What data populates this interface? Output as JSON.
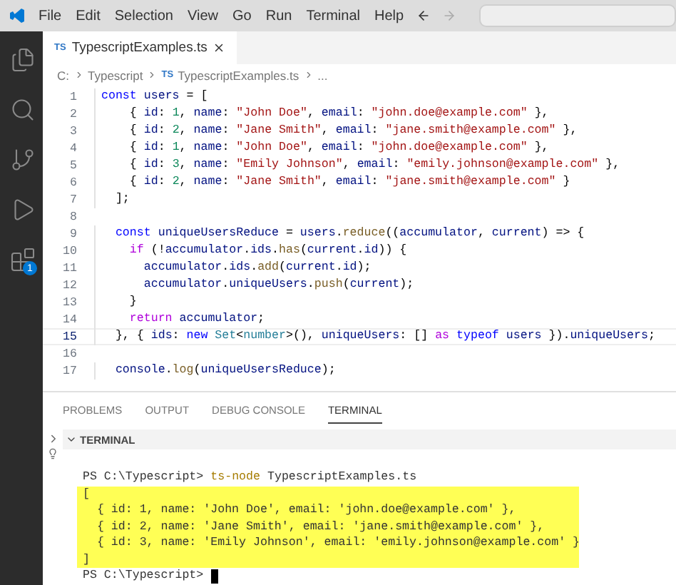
{
  "menu": [
    "File",
    "Edit",
    "Selection",
    "View",
    "Go",
    "Run",
    "Terminal",
    "Help"
  ],
  "activity_bar": [
    {
      "kind": "files",
      "selected": false
    },
    {
      "kind": "search",
      "selected": false
    },
    {
      "kind": "source-control",
      "selected": false
    },
    {
      "kind": "run",
      "selected": false
    },
    {
      "kind": "extensions",
      "selected": false,
      "badge": "1"
    }
  ],
  "editor_tab": {
    "badge": "TS",
    "title": "TypescriptExamples.ts"
  },
  "breadcrumbs": [
    {
      "text": "C:"
    },
    {
      "text": "Typescript"
    },
    {
      "badge": "TS",
      "text": "TypescriptExamples.ts"
    },
    {
      "text": "..."
    }
  ],
  "code": [
    {
      "number": "1",
      "current": false,
      "tokens": [
        {
          "kind": "k",
          "text": "const"
        },
        {
          "kind": "v",
          "text": " users"
        },
        {
          "kind": "p",
          "text": " = ["
        }
      ]
    },
    {
      "number": "2",
      "current": false,
      "tokens": [
        {
          "kind": "p",
          "text": "    { "
        },
        {
          "kind": "v",
          "text": "id"
        },
        {
          "kind": "p",
          "text": ": "
        },
        {
          "kind": "n",
          "text": "1"
        },
        {
          "kind": "p",
          "text": ", "
        },
        {
          "kind": "v",
          "text": "name"
        },
        {
          "kind": "p",
          "text": ": "
        },
        {
          "kind": "s",
          "text": "\"John Doe\""
        },
        {
          "kind": "p",
          "text": ", "
        },
        {
          "kind": "v",
          "text": "email"
        },
        {
          "kind": "p",
          "text": ": "
        },
        {
          "kind": "s",
          "text": "\"john.doe@example.com\""
        },
        {
          "kind": "p",
          "text": " },"
        }
      ]
    },
    {
      "number": "3",
      "current": false,
      "tokens": [
        {
          "kind": "p",
          "text": "    { "
        },
        {
          "kind": "v",
          "text": "id"
        },
        {
          "kind": "p",
          "text": ": "
        },
        {
          "kind": "n",
          "text": "2"
        },
        {
          "kind": "p",
          "text": ", "
        },
        {
          "kind": "v",
          "text": "name"
        },
        {
          "kind": "p",
          "text": ": "
        },
        {
          "kind": "s",
          "text": "\"Jane Smith\""
        },
        {
          "kind": "p",
          "text": ", "
        },
        {
          "kind": "v",
          "text": "email"
        },
        {
          "kind": "p",
          "text": ": "
        },
        {
          "kind": "s",
          "text": "\"jane.smith@example.com\""
        },
        {
          "kind": "p",
          "text": " },"
        }
      ]
    },
    {
      "number": "4",
      "current": false,
      "tokens": [
        {
          "kind": "p",
          "text": "    { "
        },
        {
          "kind": "v",
          "text": "id"
        },
        {
          "kind": "p",
          "text": ": "
        },
        {
          "kind": "n",
          "text": "1"
        },
        {
          "kind": "p",
          "text": ", "
        },
        {
          "kind": "v",
          "text": "name"
        },
        {
          "kind": "p",
          "text": ": "
        },
        {
          "kind": "s",
          "text": "\"John Doe\""
        },
        {
          "kind": "p",
          "text": ", "
        },
        {
          "kind": "v",
          "text": "email"
        },
        {
          "kind": "p",
          "text": ": "
        },
        {
          "kind": "s",
          "text": "\"john.doe@example.com\""
        },
        {
          "kind": "p",
          "text": " },"
        }
      ]
    },
    {
      "number": "5",
      "current": false,
      "tokens": [
        {
          "kind": "p",
          "text": "    { "
        },
        {
          "kind": "v",
          "text": "id"
        },
        {
          "kind": "p",
          "text": ": "
        },
        {
          "kind": "n",
          "text": "3"
        },
        {
          "kind": "p",
          "text": ", "
        },
        {
          "kind": "v",
          "text": "name"
        },
        {
          "kind": "p",
          "text": ": "
        },
        {
          "kind": "s",
          "text": "\"Emily Johnson\""
        },
        {
          "kind": "p",
          "text": ", "
        },
        {
          "kind": "v",
          "text": "email"
        },
        {
          "kind": "p",
          "text": ": "
        },
        {
          "kind": "s",
          "text": "\"emily.johnson@example.com\""
        },
        {
          "kind": "p",
          "text": " },"
        }
      ]
    },
    {
      "number": "6",
      "current": false,
      "tokens": [
        {
          "kind": "p",
          "text": "    { "
        },
        {
          "kind": "v",
          "text": "id"
        },
        {
          "kind": "p",
          "text": ": "
        },
        {
          "kind": "n",
          "text": "2"
        },
        {
          "kind": "p",
          "text": ", "
        },
        {
          "kind": "v",
          "text": "name"
        },
        {
          "kind": "p",
          "text": ": "
        },
        {
          "kind": "s",
          "text": "\"Jane Smith\""
        },
        {
          "kind": "p",
          "text": ", "
        },
        {
          "kind": "v",
          "text": "email"
        },
        {
          "kind": "p",
          "text": ": "
        },
        {
          "kind": "s",
          "text": "\"jane.smith@example.com\""
        },
        {
          "kind": "p",
          "text": " }"
        }
      ]
    },
    {
      "number": "7",
      "current": false,
      "tokens": [
        {
          "kind": "p",
          "text": "  ];"
        }
      ]
    },
    {
      "number": "8",
      "current": false
    },
    {
      "number": "9",
      "current": false,
      "tokens": [
        {
          "kind": "k",
          "text": "  const"
        },
        {
          "kind": "v",
          "text": " uniqueUsersReduce"
        },
        {
          "kind": "p",
          "text": " = "
        },
        {
          "kind": "v",
          "text": "users"
        },
        {
          "kind": "p",
          "text": "."
        },
        {
          "kind": "f",
          "text": "reduce"
        },
        {
          "kind": "p",
          "text": "(("
        },
        {
          "kind": "v",
          "text": "accumulator"
        },
        {
          "kind": "p",
          "text": ", "
        },
        {
          "kind": "v",
          "text": "current"
        },
        {
          "kind": "p",
          "text": ") => {"
        }
      ]
    },
    {
      "number": "10",
      "current": false,
      "tokens": [
        {
          "kind": "c",
          "text": "    if"
        },
        {
          "kind": "p",
          "text": " (!"
        },
        {
          "kind": "v",
          "text": "accumulator"
        },
        {
          "kind": "p",
          "text": "."
        },
        {
          "kind": "v",
          "text": "ids"
        },
        {
          "kind": "p",
          "text": "."
        },
        {
          "kind": "f",
          "text": "has"
        },
        {
          "kind": "p",
          "text": "("
        },
        {
          "kind": "v",
          "text": "current"
        },
        {
          "kind": "p",
          "text": "."
        },
        {
          "kind": "v",
          "text": "id"
        },
        {
          "kind": "p",
          "text": ")) {"
        }
      ]
    },
    {
      "number": "11",
      "current": false,
      "tokens": [
        {
          "kind": "v",
          "text": "      accumulator"
        },
        {
          "kind": "p",
          "text": "."
        },
        {
          "kind": "v",
          "text": "ids"
        },
        {
          "kind": "p",
          "text": "."
        },
        {
          "kind": "f",
          "text": "add"
        },
        {
          "kind": "p",
          "text": "("
        },
        {
          "kind": "v",
          "text": "current"
        },
        {
          "kind": "p",
          "text": "."
        },
        {
          "kind": "v",
          "text": "id"
        },
        {
          "kind": "p",
          "text": ");"
        }
      ]
    },
    {
      "number": "12",
      "current": false,
      "tokens": [
        {
          "kind": "v",
          "text": "      accumulator"
        },
        {
          "kind": "p",
          "text": "."
        },
        {
          "kind": "v",
          "text": "uniqueUsers"
        },
        {
          "kind": "p",
          "text": "."
        },
        {
          "kind": "f",
          "text": "push"
        },
        {
          "kind": "p",
          "text": "("
        },
        {
          "kind": "v",
          "text": "current"
        },
        {
          "kind": "p",
          "text": ");"
        }
      ]
    },
    {
      "number": "13",
      "current": false,
      "tokens": [
        {
          "kind": "p",
          "text": "    }"
        }
      ]
    },
    {
      "number": "14",
      "current": false,
      "tokens": [
        {
          "kind": "c",
          "text": "    return"
        },
        {
          "kind": "v",
          "text": " accumulator"
        },
        {
          "kind": "p",
          "text": ";"
        }
      ]
    },
    {
      "number": "15",
      "current": true,
      "tokens": [
        {
          "kind": "p",
          "text": "  }, { "
        },
        {
          "kind": "v",
          "text": "ids"
        },
        {
          "kind": "p",
          "text": ": "
        },
        {
          "kind": "k",
          "text": "new"
        },
        {
          "kind": "t",
          "text": " Set"
        },
        {
          "kind": "p",
          "text": "<"
        },
        {
          "kind": "t",
          "text": "number"
        },
        {
          "kind": "p",
          "text": ">(), "
        },
        {
          "kind": "v",
          "text": "uniqueUsers"
        },
        {
          "kind": "p",
          "text": ": [] "
        },
        {
          "kind": "c",
          "text": "as"
        },
        {
          "kind": "k",
          "text": " typeof"
        },
        {
          "kind": "v",
          "text": " users"
        },
        {
          "kind": "p",
          "text": " })."
        },
        {
          "kind": "v",
          "text": "uniqueUsers"
        },
        {
          "kind": "p",
          "text": ";"
        }
      ]
    },
    {
      "number": "16",
      "current": false
    },
    {
      "number": "17",
      "current": false,
      "tokens": [
        {
          "kind": "v",
          "text": "  console"
        },
        {
          "kind": "p",
          "text": "."
        },
        {
          "kind": "f",
          "text": "log"
        },
        {
          "kind": "p",
          "text": "("
        },
        {
          "kind": "v",
          "text": "uniqueUsersReduce"
        },
        {
          "kind": "p",
          "text": ");"
        }
      ]
    }
  ],
  "panel_tabs": [
    {
      "label": "PROBLEMS",
      "selected": false
    },
    {
      "label": "OUTPUT",
      "selected": false
    },
    {
      "label": "DEBUG CONSOLE",
      "selected": false
    },
    {
      "label": "TERMINAL",
      "selected": true
    }
  ],
  "terminal": {
    "title": "TERMINAL",
    "expanded": true,
    "lines": [
      {
        "prompt": "PS C:\\Typescript>",
        "command": "ts-node",
        "args": "TypescriptExamples.ts",
        "highlighted": false
      },
      {
        "text": "[",
        "highlighted": true
      },
      {
        "text": "  { id: 1, name: 'John Doe', email: 'john.doe@example.com' },",
        "highlighted": true
      },
      {
        "text": "  { id: 2, name: 'Jane Smith', email: 'jane.smith@example.com' },",
        "highlighted": true
      },
      {
        "text": "  { id: 3, name: 'Emily Johnson', email: 'emily.johnson@example.com' }",
        "highlighted": true
      },
      {
        "text": "]",
        "highlighted": true
      },
      {
        "prompt": "PS C:\\Typescript>",
        "cursor": true,
        "highlighted": false
      }
    ]
  }
}
